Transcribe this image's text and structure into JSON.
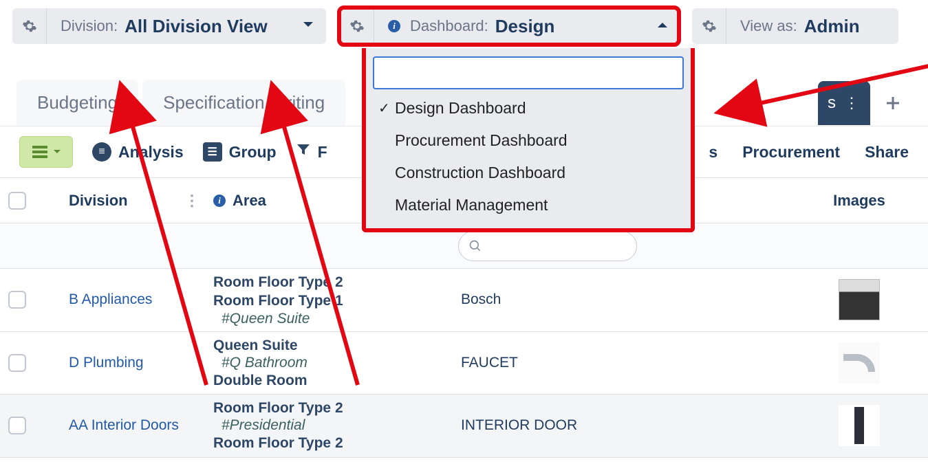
{
  "topbar": {
    "division_label": "Division:",
    "division_value": "All Division View",
    "dashboard_label": "Dashboard:",
    "dashboard_value": "Design",
    "viewas_label": "View as:",
    "viewas_value": "Admin"
  },
  "dropdown": {
    "search_placeholder": "",
    "items": [
      {
        "label": "Design Dashboard",
        "selected": true
      },
      {
        "label": "Procurement Dashboard",
        "selected": false
      },
      {
        "label": "Construction Dashboard",
        "selected": false
      },
      {
        "label": "Material Management",
        "selected": false
      }
    ]
  },
  "tabs": {
    "items": [
      {
        "label": "Budgeting"
      },
      {
        "label": "Specification Writing"
      }
    ],
    "partial_label": "s"
  },
  "toolbar": {
    "analysis": "Analysis",
    "group": "Group",
    "filter_prefix": "F",
    "right_partial": "s",
    "procurement": "Procurement",
    "share": "Share"
  },
  "columns": {
    "division": "Division",
    "area": "Area",
    "images": "Images"
  },
  "rows": [
    {
      "division": "B Appliances",
      "area_lines": [
        "Room Floor Type 2",
        "Room Floor Type 1"
      ],
      "area_sub": "#Queen Suite",
      "desc": "Bosch",
      "thumb": "oven"
    },
    {
      "division": "D Plumbing",
      "area_lines": [
        "Queen Suite"
      ],
      "area_sub": "#Q Bathroom",
      "area_trail": "Double Room",
      "desc": "FAUCET",
      "thumb": "faucet"
    },
    {
      "division": "AA Interior Doors",
      "area_lines": [
        "Room Floor Type 2"
      ],
      "area_sub": "#Presidential",
      "area_trail": "Room Floor Type 2",
      "desc": "INTERIOR DOOR",
      "thumb": "door"
    }
  ]
}
